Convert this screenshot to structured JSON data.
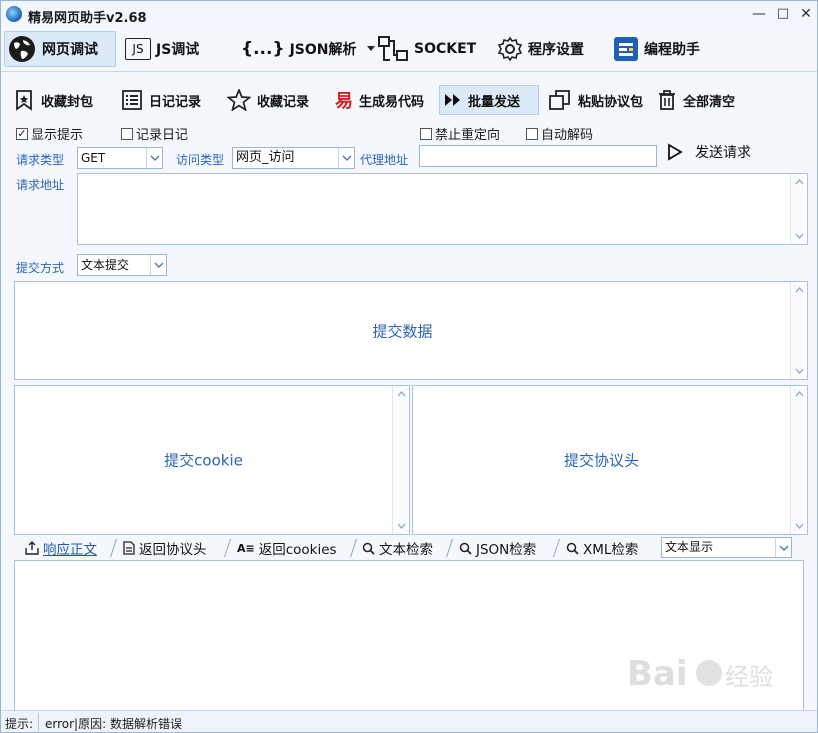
{
  "window": {
    "title": "精易网页助手v2.68",
    "minimize": "—",
    "maximize": "□",
    "close": "✕"
  },
  "main_tabs": [
    {
      "label": "网页调试",
      "icon": "globe-icon",
      "active": true
    },
    {
      "label": "JS调试",
      "icon": "js-icon",
      "badge": "JS"
    },
    {
      "label": "JSON解析",
      "icon": "json-braces-icon",
      "badge": "{...}"
    },
    {
      "label": "SOCKET",
      "icon": "socket-icon"
    },
    {
      "label": "程序设置",
      "icon": "gear-icon"
    },
    {
      "label": "编程助手",
      "icon": "helper-icon"
    }
  ],
  "toolbar": [
    {
      "label": "收藏封包",
      "icon": "bookmark-icon"
    },
    {
      "label": "日记记录",
      "icon": "list-icon"
    },
    {
      "label": "收藏记录",
      "icon": "star-icon"
    },
    {
      "label": "生成易代码",
      "icon": "yi-icon",
      "glyph": "易"
    },
    {
      "label": "批量发送",
      "icon": "fast-forward-icon",
      "active": true
    },
    {
      "label": "粘贴协议包",
      "icon": "paste-icon"
    },
    {
      "label": "全部清空",
      "icon": "trash-icon"
    }
  ],
  "checkboxes": {
    "show_tips": {
      "label": "显示提示",
      "checked": true
    },
    "log_diary": {
      "label": "记录日记",
      "checked": false
    },
    "no_redirect": {
      "label": "禁止重定向",
      "checked": false
    },
    "auto_decode": {
      "label": "自动解码",
      "checked": false
    }
  },
  "request": {
    "type_label": "请求类型",
    "type_value": "GET",
    "visit_label": "访问类型",
    "visit_value": "网页_访问",
    "proxy_label": "代理地址",
    "proxy_value": "",
    "url_label": "请求地址",
    "url_value": "",
    "send_label": "发送请求",
    "submit_method_label": "提交方式",
    "submit_method_value": "文本提交"
  },
  "panels": {
    "post_data": "提交数据",
    "cookie": "提交cookie",
    "headers": "提交协议头"
  },
  "response_tabs": [
    {
      "label": "响应正文",
      "icon": "response-icon",
      "active": true
    },
    {
      "label": "返回协议头",
      "icon": "document-icon"
    },
    {
      "label": "返回cookies",
      "icon": "cookies-icon"
    },
    {
      "label": "文本检索",
      "icon": "search-icon"
    },
    {
      "label": "JSON检索",
      "icon": "search-icon"
    },
    {
      "label": "XML检索",
      "icon": "search-icon"
    }
  ],
  "display_mode": "文本显示",
  "status": {
    "label": "提示:",
    "message": "error|原因: 数据解析错误"
  },
  "colors": {
    "accent_text": "#2b63b8",
    "window_bg": "#f4f8fc",
    "active_tab_bg": "#dbe9f8",
    "border": "#9bb6d4"
  }
}
